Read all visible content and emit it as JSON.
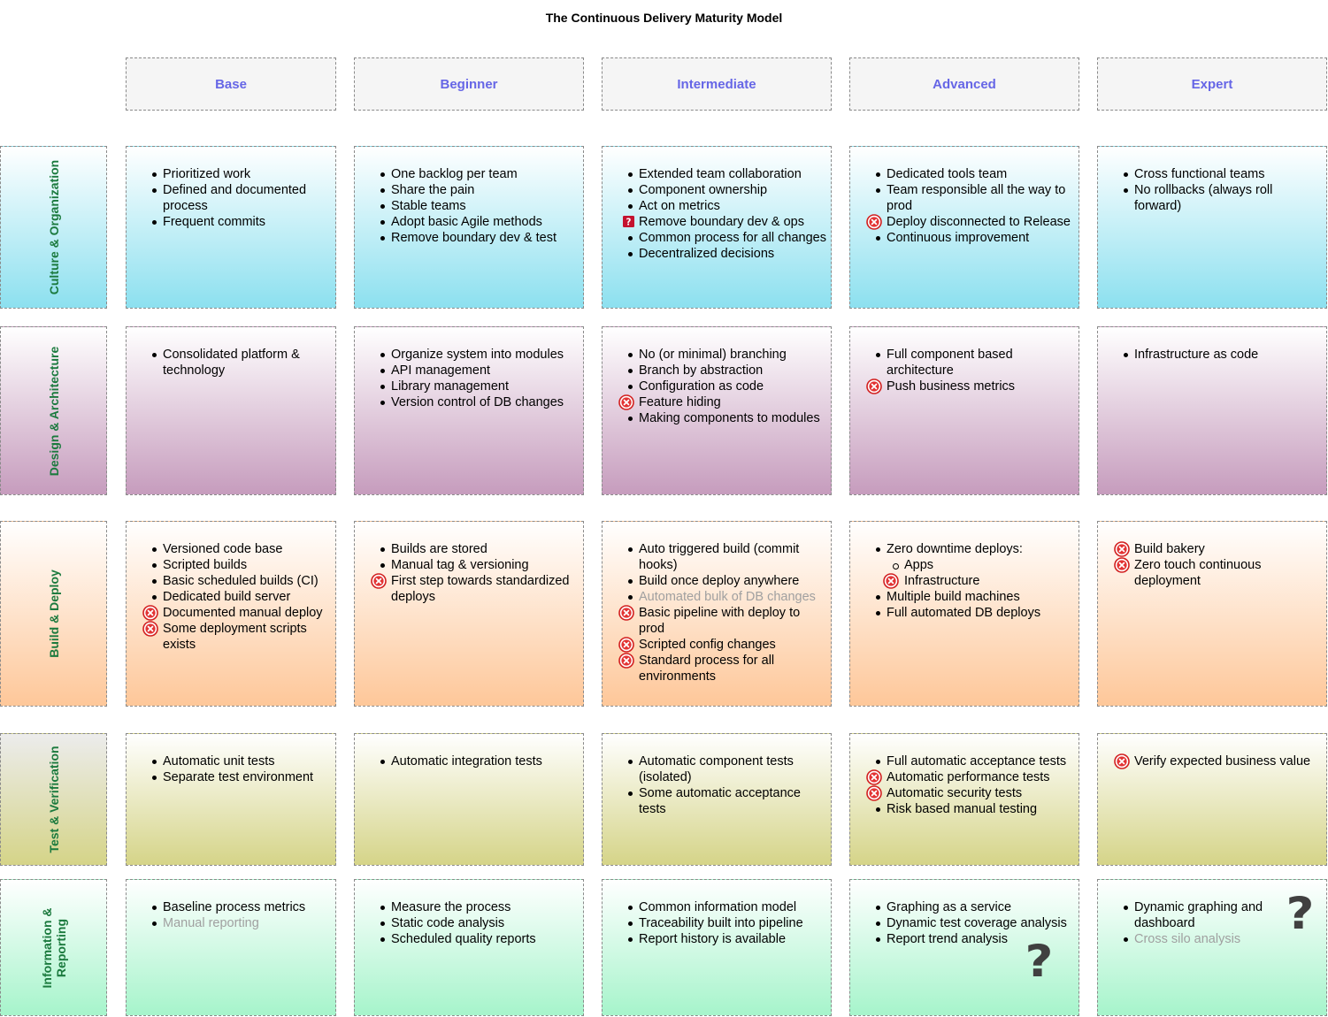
{
  "title": "The Continuous Delivery Maturity Model",
  "columns": [
    "Base",
    "Beginner",
    "Intermediate",
    "Advanced",
    "Expert"
  ],
  "rows": [
    {
      "label": "Culture & Organization",
      "cells": [
        [
          {
            "text": "Prioritized work"
          },
          {
            "text": "Defined and documented process"
          },
          {
            "text": "Frequent commits"
          }
        ],
        [
          {
            "text": "One backlog per team"
          },
          {
            "text": "Share the pain"
          },
          {
            "text": "Stable teams"
          },
          {
            "text": "Adopt basic Agile methods"
          },
          {
            "text": "Remove boundary dev & test"
          }
        ],
        [
          {
            "text": "Extended team collaboration"
          },
          {
            "text": "Component ownership"
          },
          {
            "text": "Act on metrics"
          },
          {
            "text": "Remove boundary dev & ops",
            "icon": "question-box-icon"
          },
          {
            "text": "Common process for all changes"
          },
          {
            "text": "Decentralized decisions"
          }
        ],
        [
          {
            "text": "Dedicated tools team"
          },
          {
            "text": "Team responsible all the way to prod"
          },
          {
            "text": "Deploy disconnected to Release",
            "icon": "red-x-icon"
          },
          {
            "text": "Continuous improvement"
          }
        ],
        [
          {
            "text": "Cross functional teams"
          },
          {
            "text": "No rollbacks (always roll forward)"
          }
        ]
      ]
    },
    {
      "label": "Design & Architecture",
      "cells": [
        [
          {
            "text": "Consolidated platform & technology"
          }
        ],
        [
          {
            "text": "Organize system into modules"
          },
          {
            "text": "API management"
          },
          {
            "text": "Library management"
          },
          {
            "text": "Version control of DB changes"
          }
        ],
        [
          {
            "text": "No (or minimal) branching"
          },
          {
            "text": "Branch by abstraction"
          },
          {
            "text": "Configuration as code"
          },
          {
            "text": "Feature hiding",
            "icon": "red-x-icon"
          },
          {
            "text": "Making components to modules"
          }
        ],
        [
          {
            "text": "Full component based architecture"
          },
          {
            "text": "Push business metrics",
            "icon": "red-x-icon"
          }
        ],
        [
          {
            "text": "Infrastructure as code"
          }
        ]
      ]
    },
    {
      "label": "Build & Deploy",
      "cells": [
        [
          {
            "text": "Versioned code base"
          },
          {
            "text": "Scripted builds"
          },
          {
            "text": "Basic scheduled builds (CI)"
          },
          {
            "text": "Dedicated build server"
          },
          {
            "text": "Documented manual deploy",
            "icon": "red-x-icon"
          },
          {
            "text": "Some deployment scripts exists",
            "icon": "red-x-icon"
          }
        ],
        [
          {
            "text": "Builds are stored"
          },
          {
            "text": "Manual tag & versioning"
          },
          {
            "text": "First step towards standardized deploys",
            "icon": "red-x-icon"
          }
        ],
        [
          {
            "text": "Auto triggered build (commit hooks)"
          },
          {
            "text": "Build once deploy anywhere"
          },
          {
            "text": "Automated bulk of DB changes",
            "gray": true
          },
          {
            "text": "Basic pipeline with deploy to prod",
            "icon": "red-x-icon"
          },
          {
            "text": "Scripted config changes",
            "icon": "red-x-icon"
          },
          {
            "text": "Standard process for all environments",
            "icon": "red-x-icon"
          }
        ],
        [
          {
            "text": "Zero downtime deploys:"
          },
          {
            "text": "Apps",
            "sub": true
          },
          {
            "text": "Infrastructure",
            "sub": true,
            "icon": "red-x-icon"
          },
          {
            "text": "Multiple build machines"
          },
          {
            "text": "Full automated DB deploys"
          }
        ],
        [
          {
            "text": "Build bakery",
            "icon": "red-x-icon"
          },
          {
            "text": "Zero touch continuous deployment",
            "icon": "red-x-icon"
          }
        ]
      ]
    },
    {
      "label": "Test & Verification",
      "cells": [
        [
          {
            "text": "Automatic unit tests"
          },
          {
            "text": "Separate test environment"
          }
        ],
        [
          {
            "text": "Automatic integration tests"
          }
        ],
        [
          {
            "text": "Automatic component tests (isolated)"
          },
          {
            "text": "Some automatic acceptance tests"
          }
        ],
        [
          {
            "text": "Full automatic acceptance tests"
          },
          {
            "text": "Automatic performance tests",
            "icon": "red-x-icon"
          },
          {
            "text": "Automatic security tests",
            "icon": "red-x-icon"
          },
          {
            "text": "Risk based manual testing"
          }
        ],
        [
          {
            "text": "Verify expected business value",
            "icon": "red-x-icon"
          }
        ]
      ]
    },
    {
      "label": "Information &\nReporting",
      "cells": [
        [
          {
            "text": "Baseline process metrics"
          },
          {
            "text": "Manual reporting",
            "gray": true
          }
        ],
        [
          {
            "text": "Measure the process"
          },
          {
            "text": "Static code analysis"
          },
          {
            "text": "Scheduled quality reports"
          }
        ],
        [
          {
            "text": "Common information model"
          },
          {
            "text": "Traceability built into pipeline"
          },
          {
            "text": "Report history is available"
          }
        ],
        [
          {
            "text": "Graphing as a service"
          },
          {
            "text": "Dynamic test coverage analysis"
          },
          {
            "text": "Report trend analysis"
          }
        ],
        [
          {
            "text": "Dynamic graphing and dashboard"
          },
          {
            "text": "Cross silo analysis",
            "gray": true
          }
        ]
      ]
    }
  ],
  "big_question_mark": "?"
}
